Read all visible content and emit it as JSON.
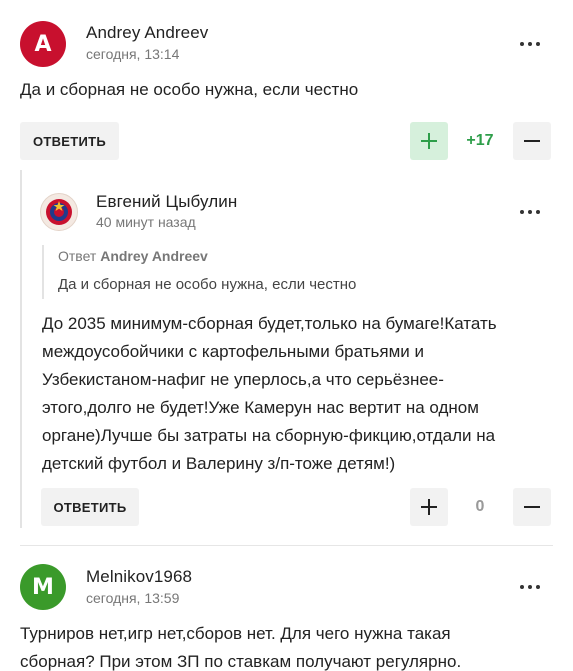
{
  "comments": [
    {
      "author": "Andrey Andreev",
      "avatar_letter": "A",
      "avatar_color": "#c8102e",
      "time": "сегодня, 13:14",
      "text": "Да и сборная не особо нужна, если честно",
      "reply_label": "ОТВЕТИТЬ",
      "score": "+17"
    },
    {
      "author": "Евгений Цыбулин",
      "avatar_logo_text": "ЦСКА",
      "time": "40 минут назад",
      "reply_to_prefix": "Ответ",
      "reply_to_author": "Andrey Andreev",
      "quote": "Да и сборная не особо нужна, если честно",
      "text_lines": [
        "До 2035 минимум-сборная будет,только на бумаге!Катать",
        "междоусобойчики с картофельными братьями и",
        "Узбекистаном-нафиг не уперлось,а что серьёзнее-",
        "этого,долго не будет!Уже Камерун нас вертит на одном",
        "органе)Лучше бы затраты на сборную-фикцию,отдали на",
        "детский футбол и Валерину з/п-тоже детям!)"
      ],
      "reply_label": "ОТВЕТИТЬ",
      "score": "0"
    },
    {
      "author": "Melnikov1968",
      "avatar_letter": "M",
      "avatar_color": "#3a9a2a",
      "time": "сегодня, 13:59",
      "text_lines": [
        "Турниров нет,игр нет,сборов нет. Для чего нужна такая",
        "сборная? При этом ЗП по ставкам получают регулярно."
      ]
    }
  ],
  "icons": {
    "more": "more-dots-icon",
    "upvote": "plus-icon",
    "downvote": "minus-icon"
  },
  "colors": {
    "positive": "#2e9e4a",
    "upvote_active_bg": "#d6f0dc",
    "button_bg": "#f2f2f2"
  }
}
